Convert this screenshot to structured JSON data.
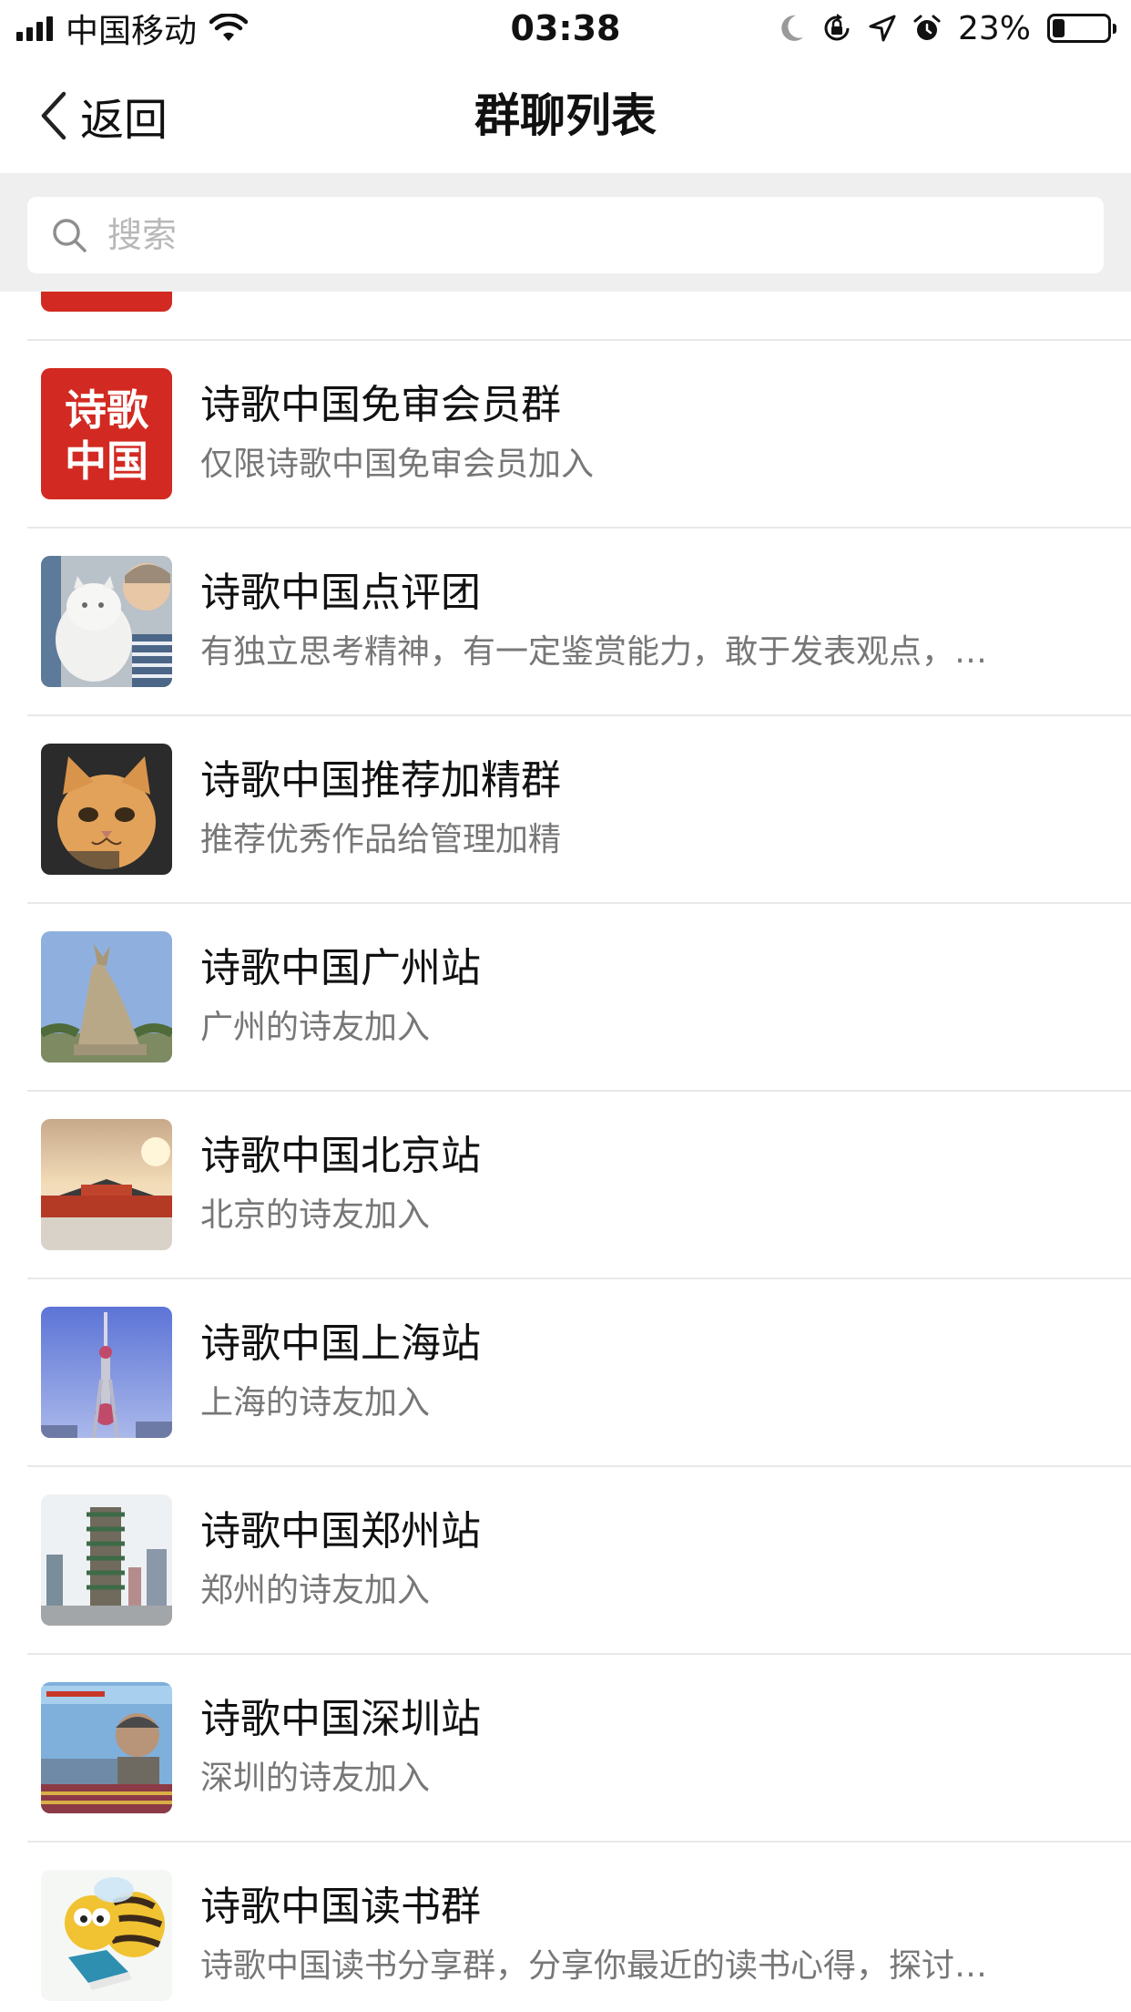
{
  "status_bar": {
    "carrier": "中国移动",
    "time": "03:38",
    "battery_percent": "23%",
    "battery_level": 0.23,
    "icons": [
      "signal-icon",
      "wifi-icon",
      "moon-icon",
      "rotation-lock-icon",
      "location-icon",
      "alarm-icon",
      "battery-icon"
    ]
  },
  "nav": {
    "back_label": "返回",
    "title": "群聊列表"
  },
  "search": {
    "placeholder": "搜索"
  },
  "groups": [
    {
      "title": "诗歌中国免审会员群",
      "subtitle": "仅限诗歌中国免审会员加入",
      "avatar": {
        "kind": "logo",
        "text": "诗歌中国",
        "bg": "#d22a22"
      }
    },
    {
      "title": "诗歌中国点评团",
      "subtitle": "有独立思考精神，有一定鉴赏能力，敢于发表观点，…",
      "avatar": {
        "kind": "photo-cat-child"
      }
    },
    {
      "title": "诗歌中国推荐加精群",
      "subtitle": "推荐优秀作品给管理加精",
      "avatar": {
        "kind": "photo-cat-face"
      }
    },
    {
      "title": "诗歌中国广州站",
      "subtitle": "广州的诗友加入",
      "avatar": {
        "kind": "photo-guangzhou-statue"
      }
    },
    {
      "title": "诗歌中国北京站",
      "subtitle": "北京的诗友加入",
      "avatar": {
        "kind": "photo-beijing-palace"
      }
    },
    {
      "title": "诗歌中国上海站",
      "subtitle": "上海的诗友加入",
      "avatar": {
        "kind": "photo-shanghai-tower"
      }
    },
    {
      "title": "诗歌中国郑州站",
      "subtitle": "郑州的诗友加入",
      "avatar": {
        "kind": "photo-zhengzhou-tower"
      }
    },
    {
      "title": "诗歌中国深圳站",
      "subtitle": "深圳的诗友加入",
      "avatar": {
        "kind": "photo-shenzhen-billboard"
      }
    },
    {
      "title": "诗歌中国读书群",
      "subtitle": "诗歌中国读书分享群，分享你最近的读书心得，探讨…",
      "avatar": {
        "kind": "cartoon-bee-book"
      }
    }
  ],
  "colors": {
    "brand_red": "#d22a22",
    "divider": "#e8e8e8",
    "search_bg": "#efefef",
    "subtitle": "#777777"
  }
}
